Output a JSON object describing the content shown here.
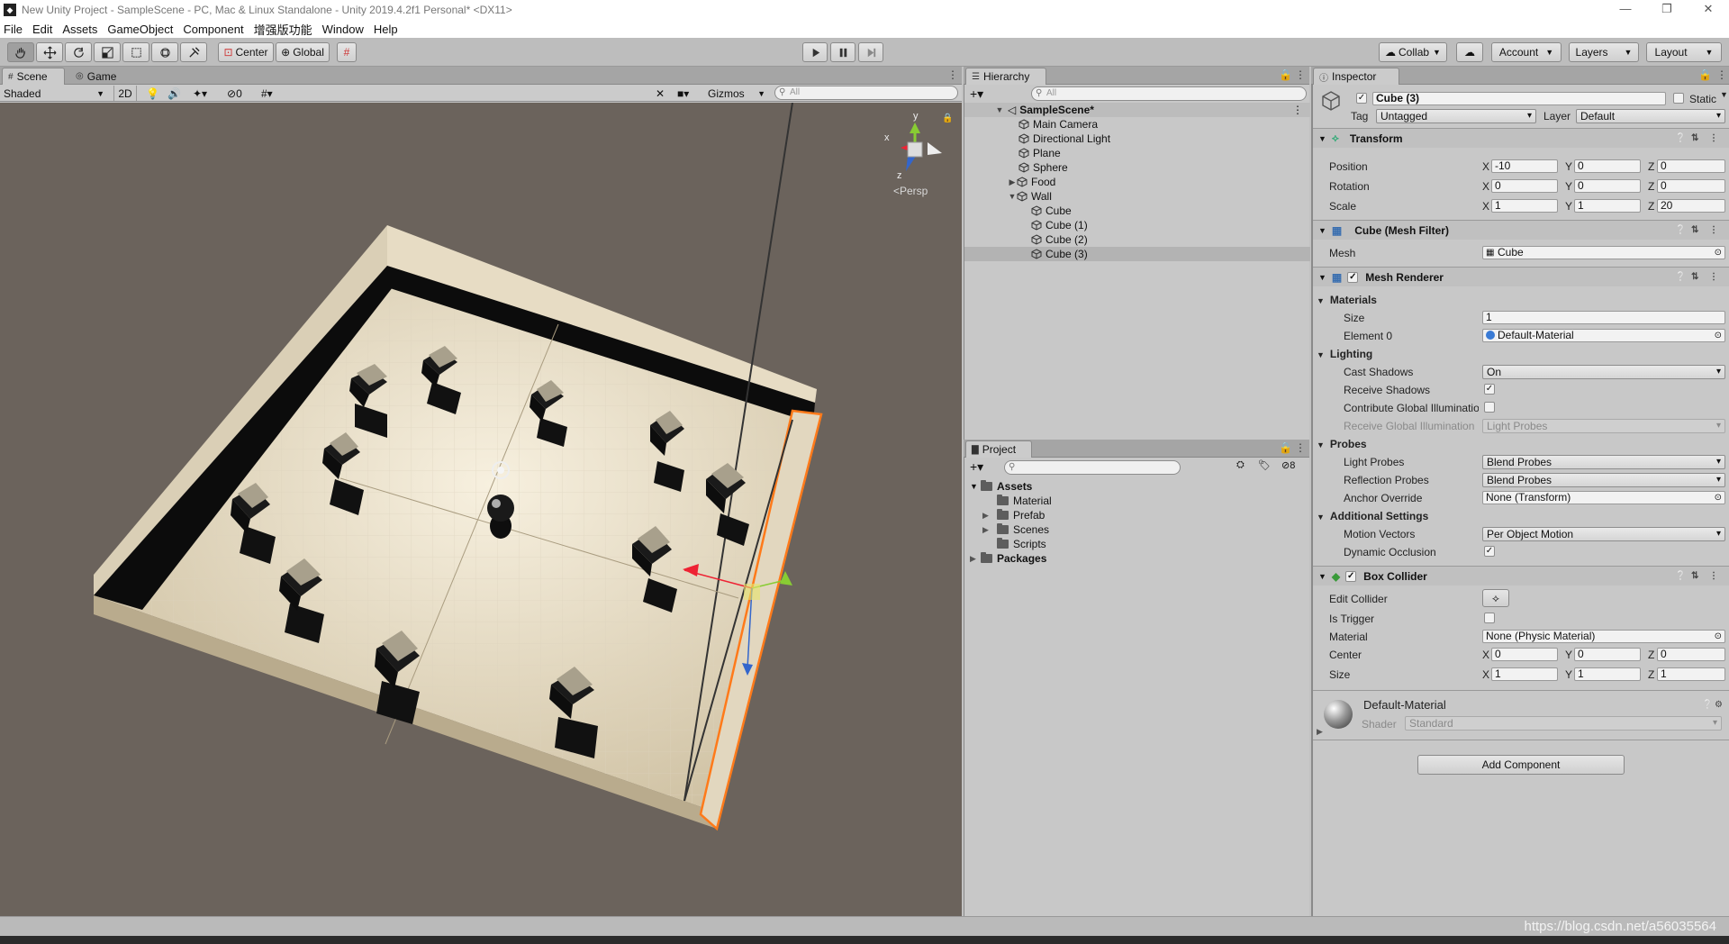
{
  "window": {
    "title": "New Unity Project - SampleScene - PC, Mac & Linux Standalone - Unity 2019.4.2f1 Personal* <DX11>",
    "controls": [
      "—",
      "❐",
      "✕"
    ]
  },
  "menu": [
    "File",
    "Edit",
    "Assets",
    "GameObject",
    "Component",
    "增强版功能",
    "Window",
    "Help"
  ],
  "toolbar": {
    "pivot_label": "Center",
    "space_label": "Global",
    "collab_label": "Collab",
    "account_label": "Account",
    "layers_label": "Layers",
    "layout_label": "Layout"
  },
  "scene_tabs": {
    "scene": "Scene",
    "game": "Game"
  },
  "scene_toolbar": {
    "shading": "Shaded",
    "mode_2d": "2D",
    "hidden_count": "0",
    "gizmos": "Gizmos",
    "search_placeholder": "All"
  },
  "scene_gizmo": {
    "persp_label": "<Persp",
    "axes": {
      "x": "x",
      "y": "y",
      "z": "z"
    }
  },
  "hierarchy": {
    "tab": "Hierarchy",
    "search_placeholder": "All",
    "scene_name": "SampleScene*",
    "items": [
      {
        "label": "Main Camera"
      },
      {
        "label": "Directional Light"
      },
      {
        "label": "Plane"
      },
      {
        "label": "Sphere"
      },
      {
        "label": "Food"
      },
      {
        "label": "Wall"
      },
      {
        "label": "Cube"
      },
      {
        "label": "Cube (1)"
      },
      {
        "label": "Cube (2)"
      },
      {
        "label": "Cube (3)"
      }
    ]
  },
  "project": {
    "tab": "Project",
    "hidden_count": "8",
    "assets": "Assets",
    "folders": [
      {
        "label": "Material"
      },
      {
        "label": "Prefab"
      },
      {
        "label": "Scenes"
      },
      {
        "label": "Scripts"
      }
    ],
    "packages": "Packages"
  },
  "inspector": {
    "tab": "Inspector",
    "object_name": "Cube (3)",
    "static_label": "Static",
    "tag_label": "Tag",
    "tag_value": "Untagged",
    "layer_label": "Layer",
    "layer_value": "Default",
    "transform": {
      "title": "Transform",
      "position_label": "Position",
      "position": [
        "-10",
        "0",
        "0"
      ],
      "rotation_label": "Rotation",
      "rotation": [
        "0",
        "0",
        "0"
      ],
      "scale_label": "Scale",
      "scale": [
        "1",
        "1",
        "20"
      ]
    },
    "mesh_filter": {
      "title": "Cube (Mesh Filter)",
      "mesh_label": "Mesh",
      "mesh_value": "Cube"
    },
    "mesh_renderer": {
      "title": "Mesh Renderer",
      "materials": "Materials",
      "size_label": "Size",
      "size_value": "1",
      "element0_label": "Element 0",
      "element0_value": "Default-Material",
      "lighting": "Lighting",
      "cast_shadows_label": "Cast Shadows",
      "cast_shadows_value": "On",
      "receive_shadows_label": "Receive Shadows",
      "contribute_gi_label": "Contribute Global Illuminatio",
      "receive_gi_label": "Receive Global Illumination",
      "receive_gi_value": "Light Probes",
      "probes": "Probes",
      "light_probes_label": "Light Probes",
      "light_probes_value": "Blend Probes",
      "reflection_probes_label": "Reflection Probes",
      "reflection_probes_value": "Blend Probes",
      "anchor_override_label": "Anchor Override",
      "anchor_override_value": "None (Transform)",
      "additional_settings": "Additional Settings",
      "motion_vectors_label": "Motion Vectors",
      "motion_vectors_value": "Per Object Motion",
      "dynamic_occlusion_label": "Dynamic Occlusion"
    },
    "box_collider": {
      "title": "Box Collider",
      "edit_collider_label": "Edit Collider",
      "is_trigger_label": "Is Trigger",
      "material_label": "Material",
      "material_value": "None (Physic Material)",
      "center_label": "Center",
      "center": [
        "0",
        "0",
        "0"
      ],
      "size_label": "Size",
      "size": [
        "1",
        "1",
        "1"
      ]
    },
    "material_preview": {
      "name": "Default-Material",
      "shader_label": "Shader",
      "shader_value": "Standard"
    },
    "add_component": "Add Component"
  },
  "watermark": "https://blog.csdn.net/a56035564",
  "axis_letters": {
    "x": "X",
    "y": "Y",
    "z": "Z"
  }
}
